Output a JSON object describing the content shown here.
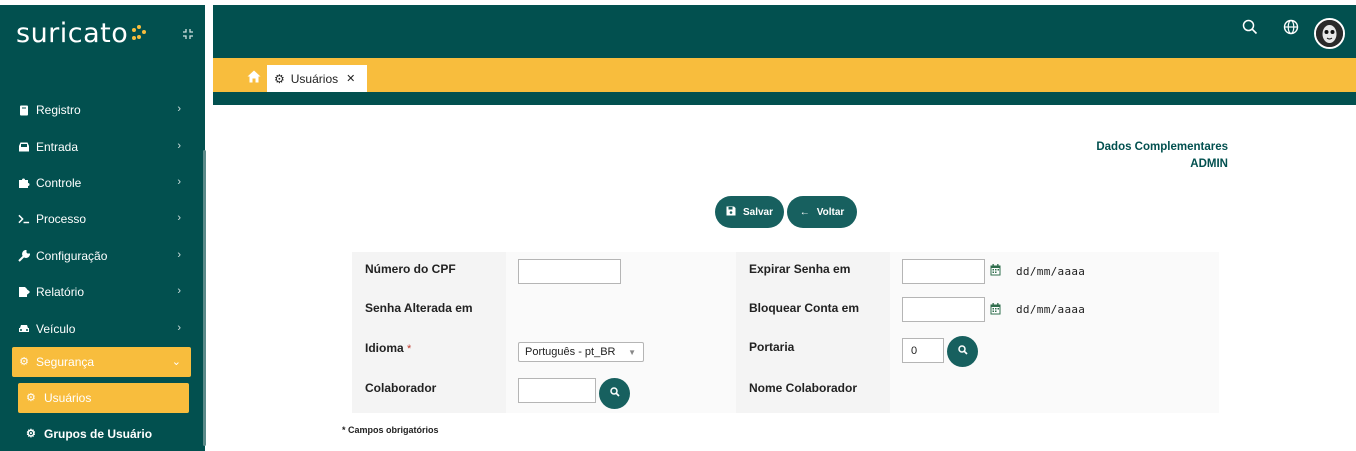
{
  "app": {
    "logo_text": "suricato",
    "collapse_icon": "collapse-icon"
  },
  "sidebar": {
    "items": [
      {
        "label": "Registro",
        "icon": "book-icon"
      },
      {
        "label": "Entrada",
        "icon": "inbox-icon"
      },
      {
        "label": "Controle",
        "icon": "puzzle-icon"
      },
      {
        "label": "Processo",
        "icon": "terminal-icon"
      },
      {
        "label": "Configuração",
        "icon": "wrench-icon"
      },
      {
        "label": "Relatório",
        "icon": "report-icon"
      },
      {
        "label": "Veículo",
        "icon": "car-icon"
      },
      {
        "label": "Segurança",
        "icon": "gear-icon",
        "active": true
      }
    ],
    "subitems": [
      {
        "label": "Usuários",
        "icon": "gear-icon",
        "active": true
      },
      {
        "label": "Grupos de Usuário",
        "icon": "gear-icon"
      }
    ]
  },
  "header": {
    "icons": [
      "search-icon",
      "globe-icon",
      "avatar"
    ]
  },
  "tabs": [
    {
      "label": "Usuários",
      "icon": "gear-icon",
      "closable": true
    }
  ],
  "info": {
    "title": "Dados Complementares",
    "subtitle": "ADMIN"
  },
  "actions": {
    "save_label": "Salvar",
    "back_label": "Voltar"
  },
  "form": {
    "cpf_label": "Número do CPF",
    "cpf_value": "",
    "senha_alterada_label": "Senha Alterada em",
    "idioma_label": "Idioma",
    "idioma_required": "*",
    "idioma_value": "Português - pt_BR",
    "colaborador_label": "Colaborador",
    "colaborador_value": "",
    "expirar_label": "Expirar Senha em",
    "expirar_value": "",
    "expirar_format": "dd/mm/aaaa",
    "bloquear_label": "Bloquear Conta em",
    "bloquear_value": "",
    "bloquear_format": "dd/mm/aaaa",
    "portaria_label": "Portaria",
    "portaria_value": "0",
    "nome_colaborador_label": "Nome Colaborador"
  },
  "footer": {
    "required_note": "* Campos obrigatórios"
  },
  "colors": {
    "primary": "#02504f",
    "accent": "#f8bd3d",
    "button": "#17605f"
  }
}
